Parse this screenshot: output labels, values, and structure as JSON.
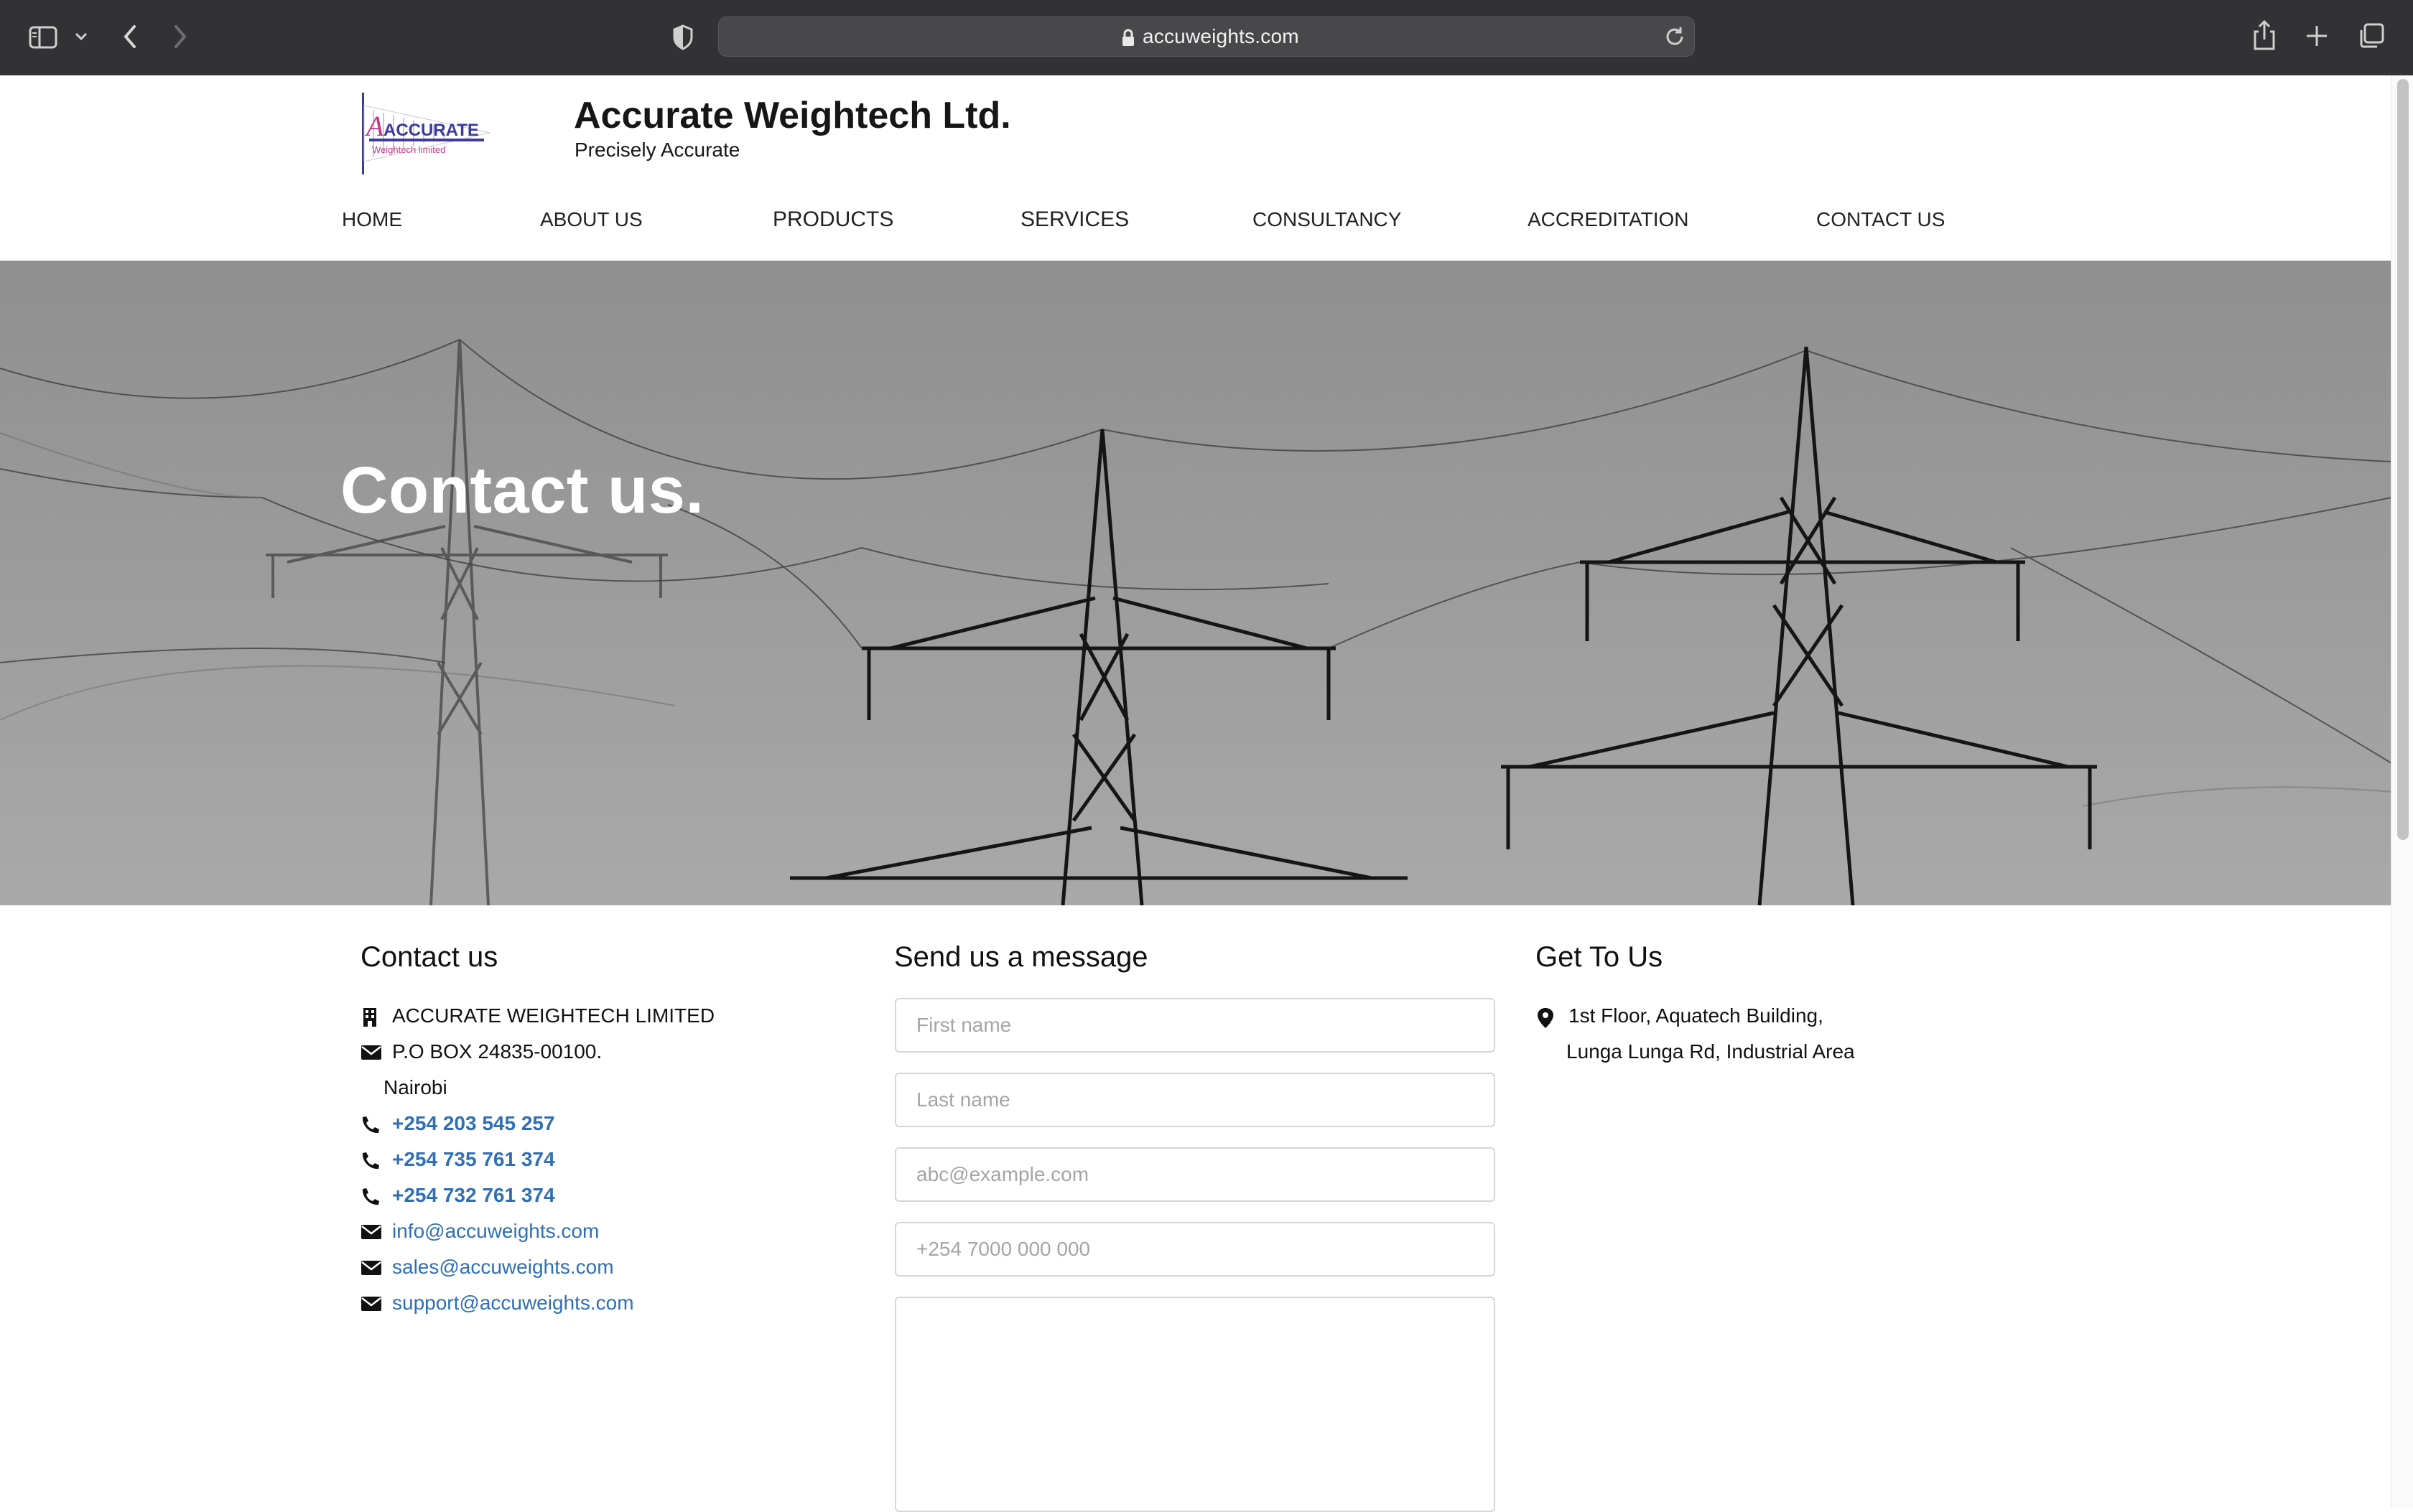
{
  "browser": {
    "url": "accuweights.com"
  },
  "header": {
    "logo_text_main": "ACCURATE",
    "logo_text_sub": "Weightech limited",
    "title": "Accurate Weightech Ltd.",
    "tagline": "Precisely Accurate"
  },
  "nav": {
    "items": [
      {
        "label": "HOME"
      },
      {
        "label": "ABOUT US"
      },
      {
        "label": "PRODUCTS"
      },
      {
        "label": "SERVICES"
      },
      {
        "label": "CONSULTANCY"
      },
      {
        "label": "ACCREDITATION"
      },
      {
        "label": "CONTACT US"
      }
    ]
  },
  "hero": {
    "title": "Contact us."
  },
  "contact": {
    "heading": "Contact us",
    "company": "ACCURATE WEIGHTECH LIMITED",
    "po_box": "P.O BOX 24835-00100.",
    "city": "Nairobi",
    "phones": [
      "+254 203 545 257",
      "+254 735 761 374",
      "+254 732 761 374"
    ],
    "emails": [
      "info@accuweights.com",
      "sales@accuweights.com",
      "support@accuweights.com"
    ],
    "icons": {
      "company": "building-icon",
      "po_box": "envelope-icon",
      "phone": "phone-icon",
      "email": "envelope-icon"
    },
    "link_color": "#2f6fb5"
  },
  "message_form": {
    "heading": "Send us a message",
    "first_name_placeholder": "First name",
    "last_name_placeholder": "Last name",
    "email_placeholder": "abc@example.com",
    "phone_placeholder": "+254 7000 000 000",
    "message_placeholder": ""
  },
  "location": {
    "heading": "Get To Us",
    "line1": "1st Floor, Aquatech Building,",
    "line2": "Lunga Lunga Rd, Industrial Area",
    "icon": "map-pin-icon"
  }
}
